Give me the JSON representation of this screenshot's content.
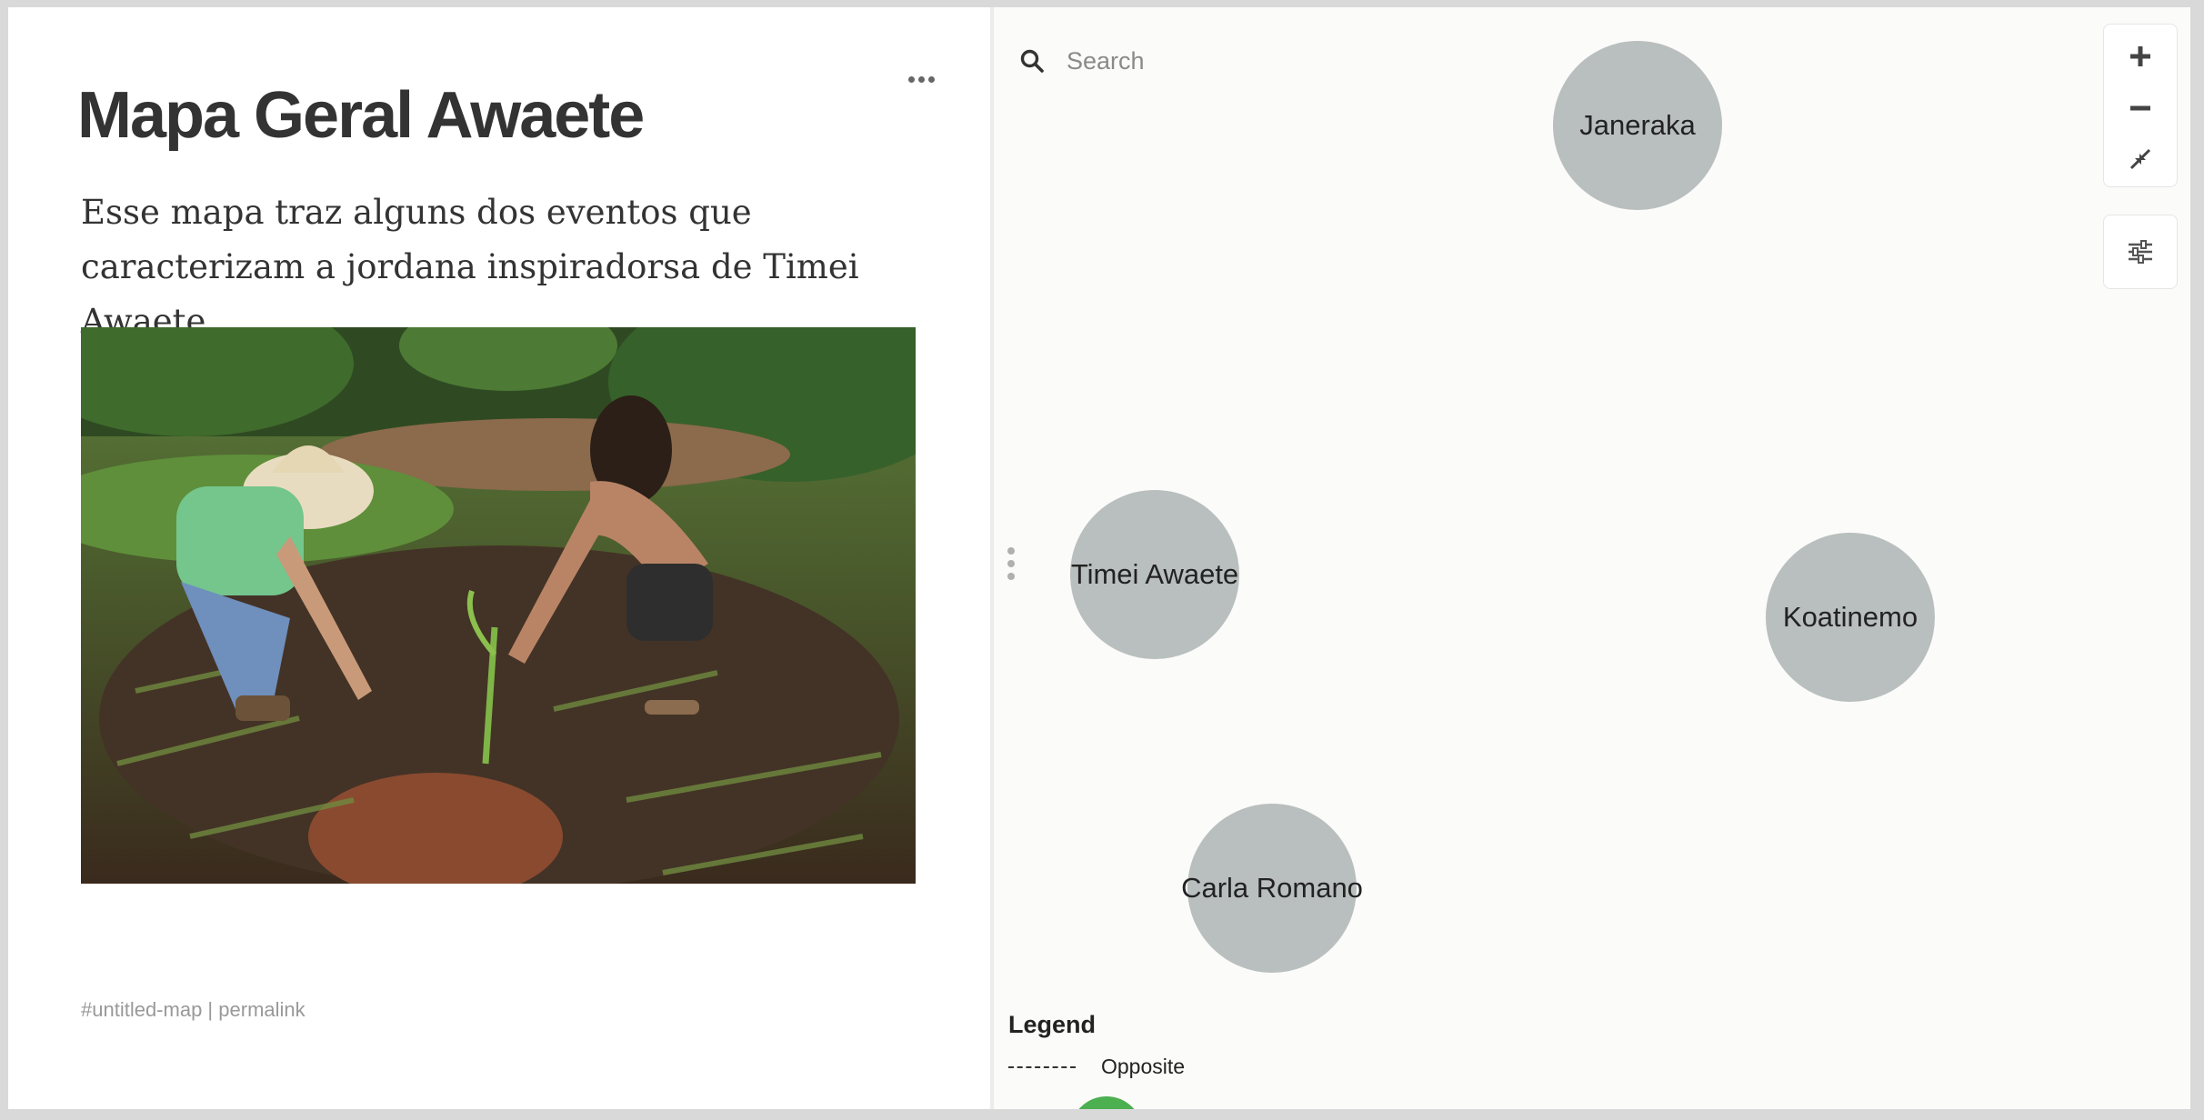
{
  "map": {
    "title": "Mapa Geral Awaete",
    "description": "Esse mapa traz alguns dos eventos que caracterizam a jordana inspiradorsa de Timei Awaete.",
    "photo_icon": "photo-two-people-planting",
    "footer": {
      "hashtag": "#untitled-map",
      "separator": " | ",
      "permalink": "permalink"
    }
  },
  "search": {
    "placeholder": "Search",
    "icon": "search-icon"
  },
  "nodes": [
    {
      "label": "Janeraka"
    },
    {
      "label": "Timei Awaete"
    },
    {
      "label": "Koatinemo"
    },
    {
      "label": "Carla Romano"
    }
  ],
  "controls": {
    "zoom_in": "plus-icon",
    "zoom_out": "minus-icon",
    "fit": "compress-icon",
    "settings": "sliders-icon"
  },
  "legend": {
    "title": "Legend",
    "items": [
      {
        "style": "dashed",
        "label": "Opposite"
      }
    ]
  },
  "colors": {
    "node_fill": "#b9bfbe",
    "fab": "#4caf50"
  }
}
